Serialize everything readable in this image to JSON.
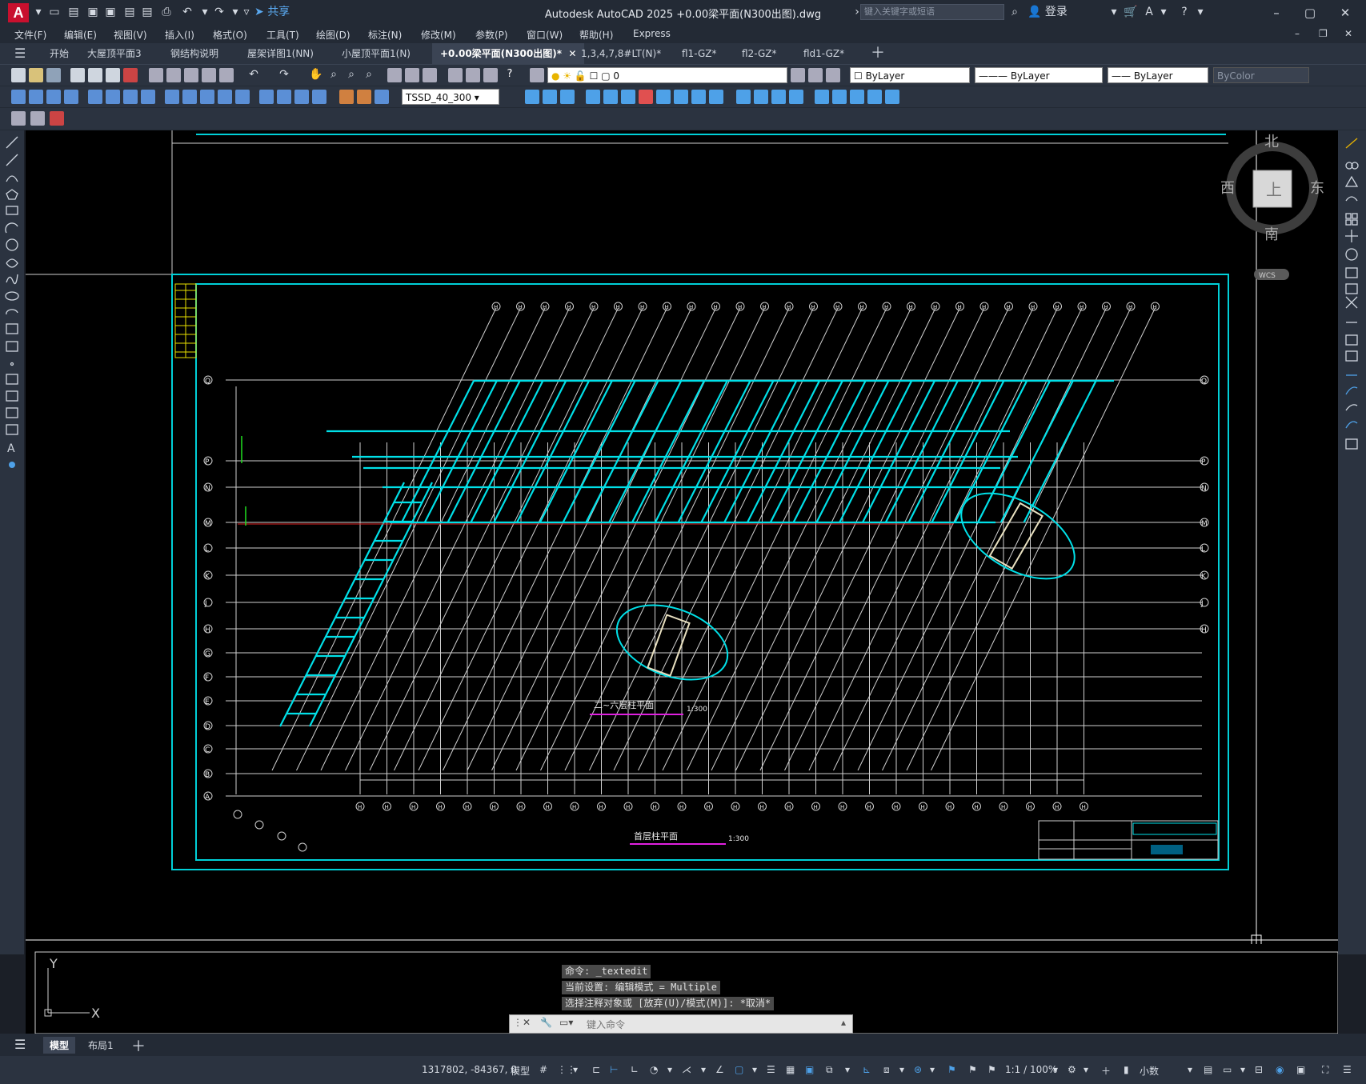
{
  "app": {
    "logo": "A",
    "window_title": "Autodesk AutoCAD 2025     +0.00梁平面(N300出图).dwg",
    "share_label": "共享",
    "search_placeholder": "键入关键字或短语",
    "login_label": "登录"
  },
  "menus": [
    "文件(F)",
    "编辑(E)",
    "视图(V)",
    "插入(I)",
    "格式(O)",
    "工具(T)",
    "绘图(D)",
    "标注(N)",
    "修改(M)",
    "参数(P)",
    "窗口(W)",
    "帮助(H)",
    "Express"
  ],
  "tabs": [
    "开始",
    "大屋顶平面3",
    "钢结构说明",
    "屋架详图1(NN)",
    "小屋顶平面1(N)",
    "+0.00梁平面(N300出图)*",
    "1,3,4,7,8#LT(N)*",
    "fl1-GZ*",
    "fl2-GZ*",
    "fld1-GZ*"
  ],
  "active_tab_index": 5,
  "properties": {
    "layer": "0",
    "color": "ByLayer",
    "linetype": "ByLayer",
    "lineweight": "ByLayer",
    "plotstyle": "ByColor",
    "dimstyle": "TSSD_40_300"
  },
  "viewcube": {
    "north": "北",
    "south": "南",
    "east": "东",
    "west": "西",
    "face": "上",
    "wcs": "WCS"
  },
  "drawing": {
    "plan_title_1": "二~六层柱平面",
    "plan_scale_1": "1:300",
    "plan_title_2": "首层柱平面",
    "plan_scale_2": "1:300",
    "row_axes": [
      "Q",
      "P",
      "N",
      "M",
      "L",
      "K",
      "J",
      "H",
      "G",
      "F",
      "E",
      "D",
      "C",
      "B",
      "A"
    ],
    "col_axis_label": "H"
  },
  "command": {
    "history": [
      "命令: _textedit",
      "当前设置: 编辑模式 = Multiple",
      "选择注释对象或 [放弃(U)/模式(M)]: *取消*"
    ],
    "input_placeholder": "键入命令"
  },
  "ucs": {
    "x_label": "X",
    "y_label": "Y"
  },
  "layout_tabs": [
    "模型",
    "布局1"
  ],
  "status": {
    "coords": "1317802, -84367, 0",
    "model_label": "模型",
    "scale": "1:1 / 100%",
    "units": "小数"
  }
}
